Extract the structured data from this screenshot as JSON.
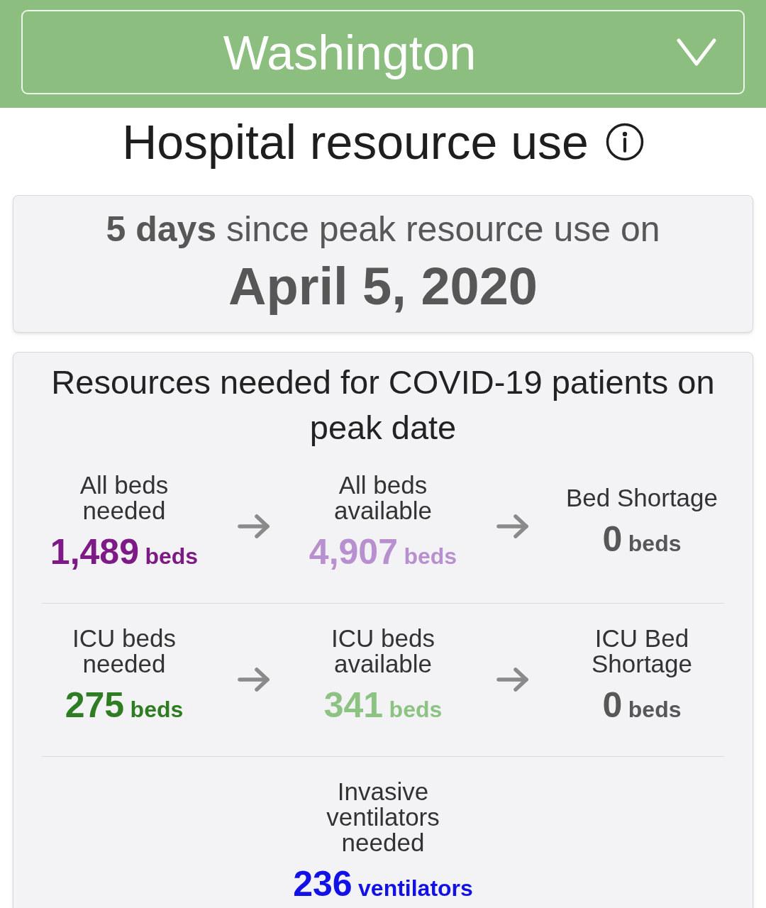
{
  "state_selector": {
    "value": "Washington"
  },
  "title": "Hospital resource use",
  "peak_card": {
    "headline": "**5 days** since peak resource use on",
    "date": "April 5, 2020"
  },
  "resources_card": {
    "heading": "Resources needed for COVID-19 patients on peak date",
    "rows": [
      {
        "items": [
          {
            "label": "All beds needed",
            "value": "1,489",
            "unit": "beds",
            "color": "#7d1a86"
          },
          {
            "label": "All beds available",
            "value": "4,907",
            "unit": "beds",
            "color": "#b890cf"
          },
          {
            "label": "Bed Shortage",
            "value": "0",
            "unit": "beds",
            "color": "#575757"
          }
        ]
      },
      {
        "items": [
          {
            "label": "ICU beds needed",
            "value": "275",
            "unit": "beds",
            "color": "#2f7d22"
          },
          {
            "label": "ICU beds available",
            "value": "341",
            "unit": "beds",
            "color": "#8cc383"
          },
          {
            "label": "ICU Bed Shortage",
            "value": "0",
            "unit": "beds",
            "color": "#575757"
          }
        ]
      },
      {
        "items": [
          {
            "label": "Invasive ventilators needed",
            "value": "236",
            "unit": "ventilators",
            "color": "#1212e6"
          }
        ]
      }
    ]
  }
}
